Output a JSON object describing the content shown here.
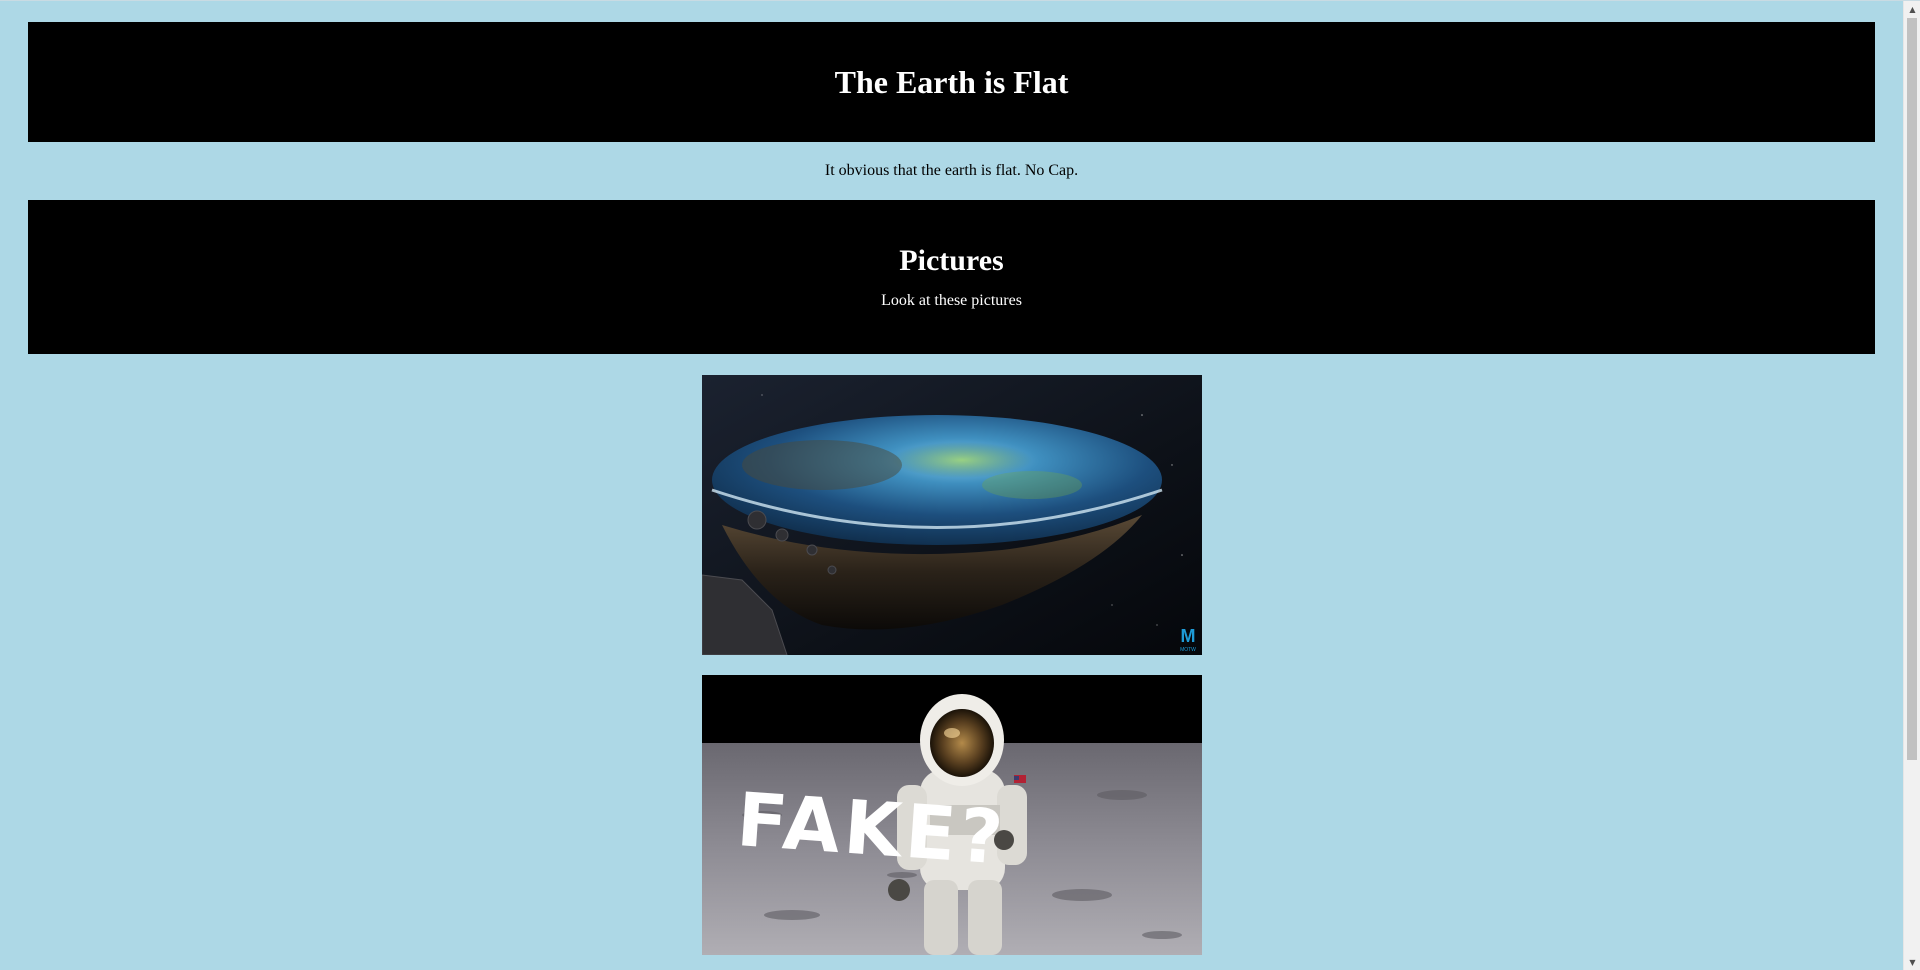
{
  "header": {
    "title": "The Earth is Flat"
  },
  "intro": {
    "text": "It obvious that the earth is flat. No Cap."
  },
  "pictures_section": {
    "heading": "Pictures",
    "subtext": "Look at these pictures"
  },
  "images": [
    {
      "name": "flat-earth-image",
      "watermark_brand": "M",
      "watermark_text": "MOTW"
    },
    {
      "name": "astronaut-moon-image",
      "overlay_text": "FAKE?"
    }
  ],
  "scrollbar": {
    "up_arrow": "▲",
    "down_arrow": "▼"
  },
  "colors": {
    "page_background": "#add8e6",
    "box_background": "#000000",
    "box_text": "#ffffff"
  }
}
